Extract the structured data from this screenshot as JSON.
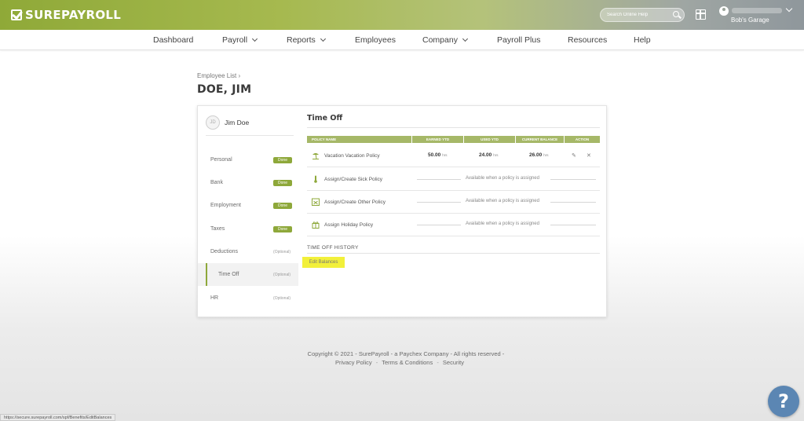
{
  "brand": {
    "logo_text": "SUREPAYROLL",
    "accent": "#8ea83a"
  },
  "topbar": {
    "search_placeholder": "Search Online Help",
    "gift_icon": "gift-icon",
    "account_company": "Bob's Garage"
  },
  "nav": {
    "items": [
      {
        "label": "Dashboard"
      },
      {
        "label": "Payroll"
      },
      {
        "label": "Reports"
      },
      {
        "label": "Employees"
      },
      {
        "label": "Company"
      },
      {
        "label": "Payroll Plus"
      },
      {
        "label": "Resources"
      },
      {
        "label": "Help"
      }
    ]
  },
  "page": {
    "breadcrumb": "Employee List ›",
    "title": "DOE, JIM"
  },
  "sidebar": {
    "avatar_initials": "JD",
    "employee_name": "Jim Doe",
    "items": [
      {
        "label": "Personal",
        "status": "Done"
      },
      {
        "label": "Bank",
        "status": "Done"
      },
      {
        "label": "Employment",
        "status": "Done"
      },
      {
        "label": "Taxes",
        "status": "Done"
      },
      {
        "label": "Deductions",
        "status": "(Optional)"
      },
      {
        "label": "Time Off",
        "status": "(Optional)"
      },
      {
        "label": "HR",
        "status": "(Optional)"
      }
    ]
  },
  "time_off": {
    "title": "Time Off",
    "columns": {
      "policy_name": "POLICY NAME",
      "earned_ytd": "EARNED YTD",
      "used_ytd": "USED YTD",
      "current_balance": "CURRENT BALANCE",
      "action": "ACTION"
    },
    "rows": [
      {
        "name": "Vacation Vacation Policy",
        "earned": "50.00",
        "used": "24.00",
        "balance": "26.00",
        "unit": "hrs",
        "icon": "beach-icon"
      },
      {
        "name": "Assign/Create Sick Policy",
        "note": "Available when a policy is assigned",
        "icon": "thermometer-icon"
      },
      {
        "name": "Assign/Create Other Policy",
        "note": "Available when a policy is assigned",
        "icon": "calendar-icon"
      },
      {
        "name": "Assign Holiday Policy",
        "note": "Available when a policy is assigned",
        "icon": "gift-icon"
      }
    ],
    "history_label": "TIME OFF HISTORY",
    "edit_balances": "Edit Balances"
  },
  "footer": {
    "copyright": "Copyright © 2021 - SurePayroll - a Paychex Company - All rights reserved -",
    "links": [
      "Privacy Policy",
      "Terms & Conditions",
      "Security"
    ],
    "separator": "-"
  },
  "help_button": "?",
  "status_url": "https://secure.surepayroll.com/spf/Benefits/EditBalances"
}
